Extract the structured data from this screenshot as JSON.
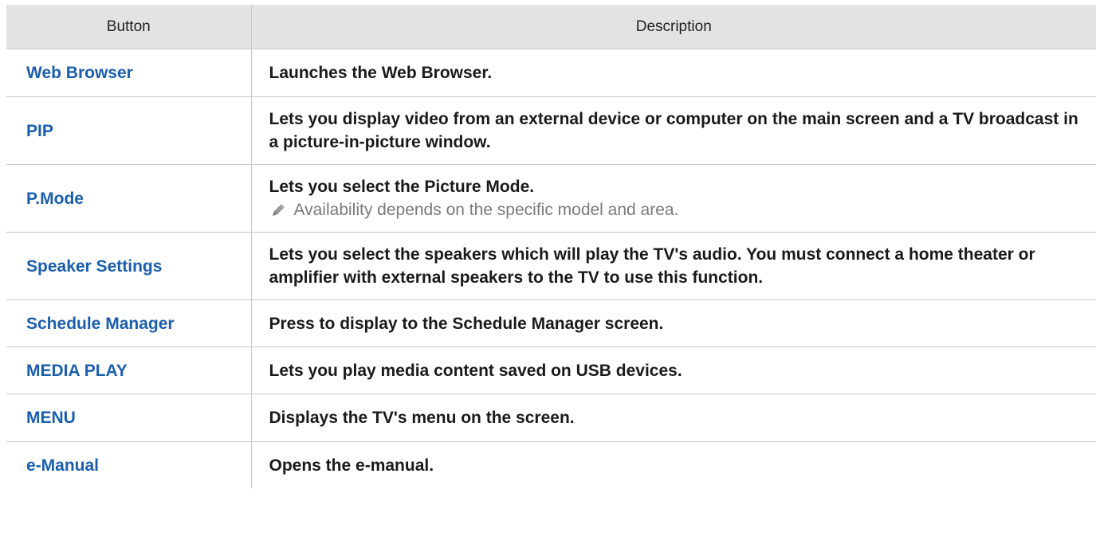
{
  "table": {
    "headers": {
      "button": "Button",
      "description": "Description"
    },
    "rows": [
      {
        "button": "Web Browser",
        "description": "Launches the Web Browser."
      },
      {
        "button": "PIP",
        "description": "Lets you display video from an external device or computer on the main screen and a TV broadcast in a picture-in-picture window."
      },
      {
        "button": "P.Mode",
        "description": "Lets you select the Picture Mode.",
        "note": "Availability depends on the specific model and area.",
        "note_icon": "pencil-icon"
      },
      {
        "button": "Speaker Settings",
        "description": "Lets you select the speakers which will play the TV's audio. You must connect a home theater or amplifier with external speakers to the TV to use this function."
      },
      {
        "button": "Schedule Manager",
        "description": "Press to display to the Schedule Manager screen."
      },
      {
        "button": "MEDIA PLAY",
        "description": "Lets you play media content saved on USB devices."
      },
      {
        "button": "MENU",
        "description": "Displays the TV's menu on the screen."
      },
      {
        "button": "e-Manual",
        "description": "Opens the e-manual."
      }
    ]
  },
  "colors": {
    "header_bg": "#e3e3e3",
    "button_text": "#1a5fae",
    "description_text": "#1a1a1a",
    "note_text": "#7a7a7a",
    "border": "#c8c8c8"
  }
}
